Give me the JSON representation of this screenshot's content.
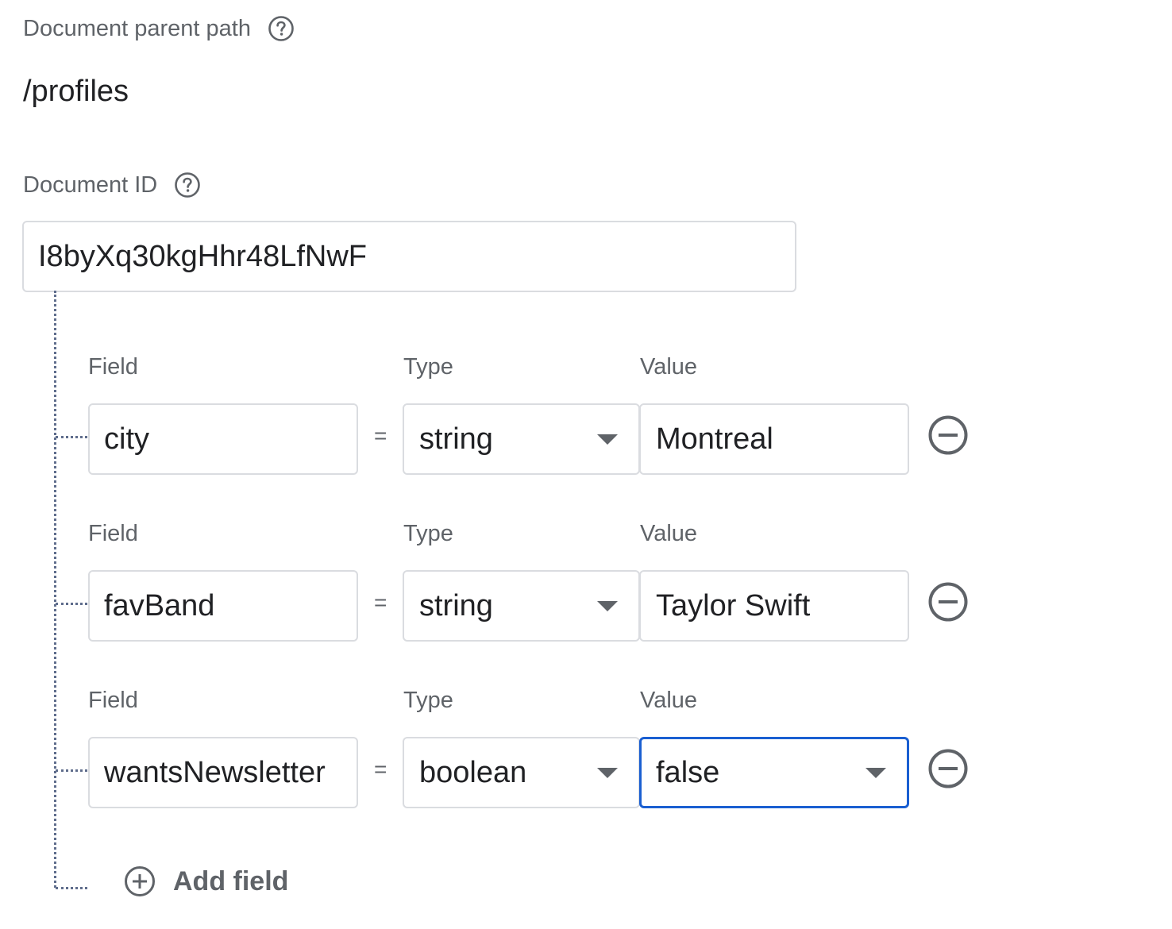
{
  "parent_path": {
    "label": "Document parent path",
    "value": "/profiles",
    "help_icon": "question-circle"
  },
  "document_id": {
    "label": "Document ID",
    "value": "I8byXq30kgHhr48LfNwF",
    "help_icon": "question-circle"
  },
  "columns": {
    "field": "Field",
    "type": "Type",
    "value": "Value"
  },
  "equals_sign": "=",
  "fields": [
    {
      "name": "city",
      "type": "string",
      "value": "Montreal"
    },
    {
      "name": "favBand",
      "type": "string",
      "value": "Taylor Swift"
    },
    {
      "name": "wantsNewsletter",
      "type": "boolean",
      "value": "false"
    }
  ],
  "add_field_label": "Add field",
  "colors": {
    "focus_border": "#1a5fd1",
    "input_border": "#dadce0",
    "muted_text": "#5f6368",
    "tree_line": "#5f6d8c"
  }
}
